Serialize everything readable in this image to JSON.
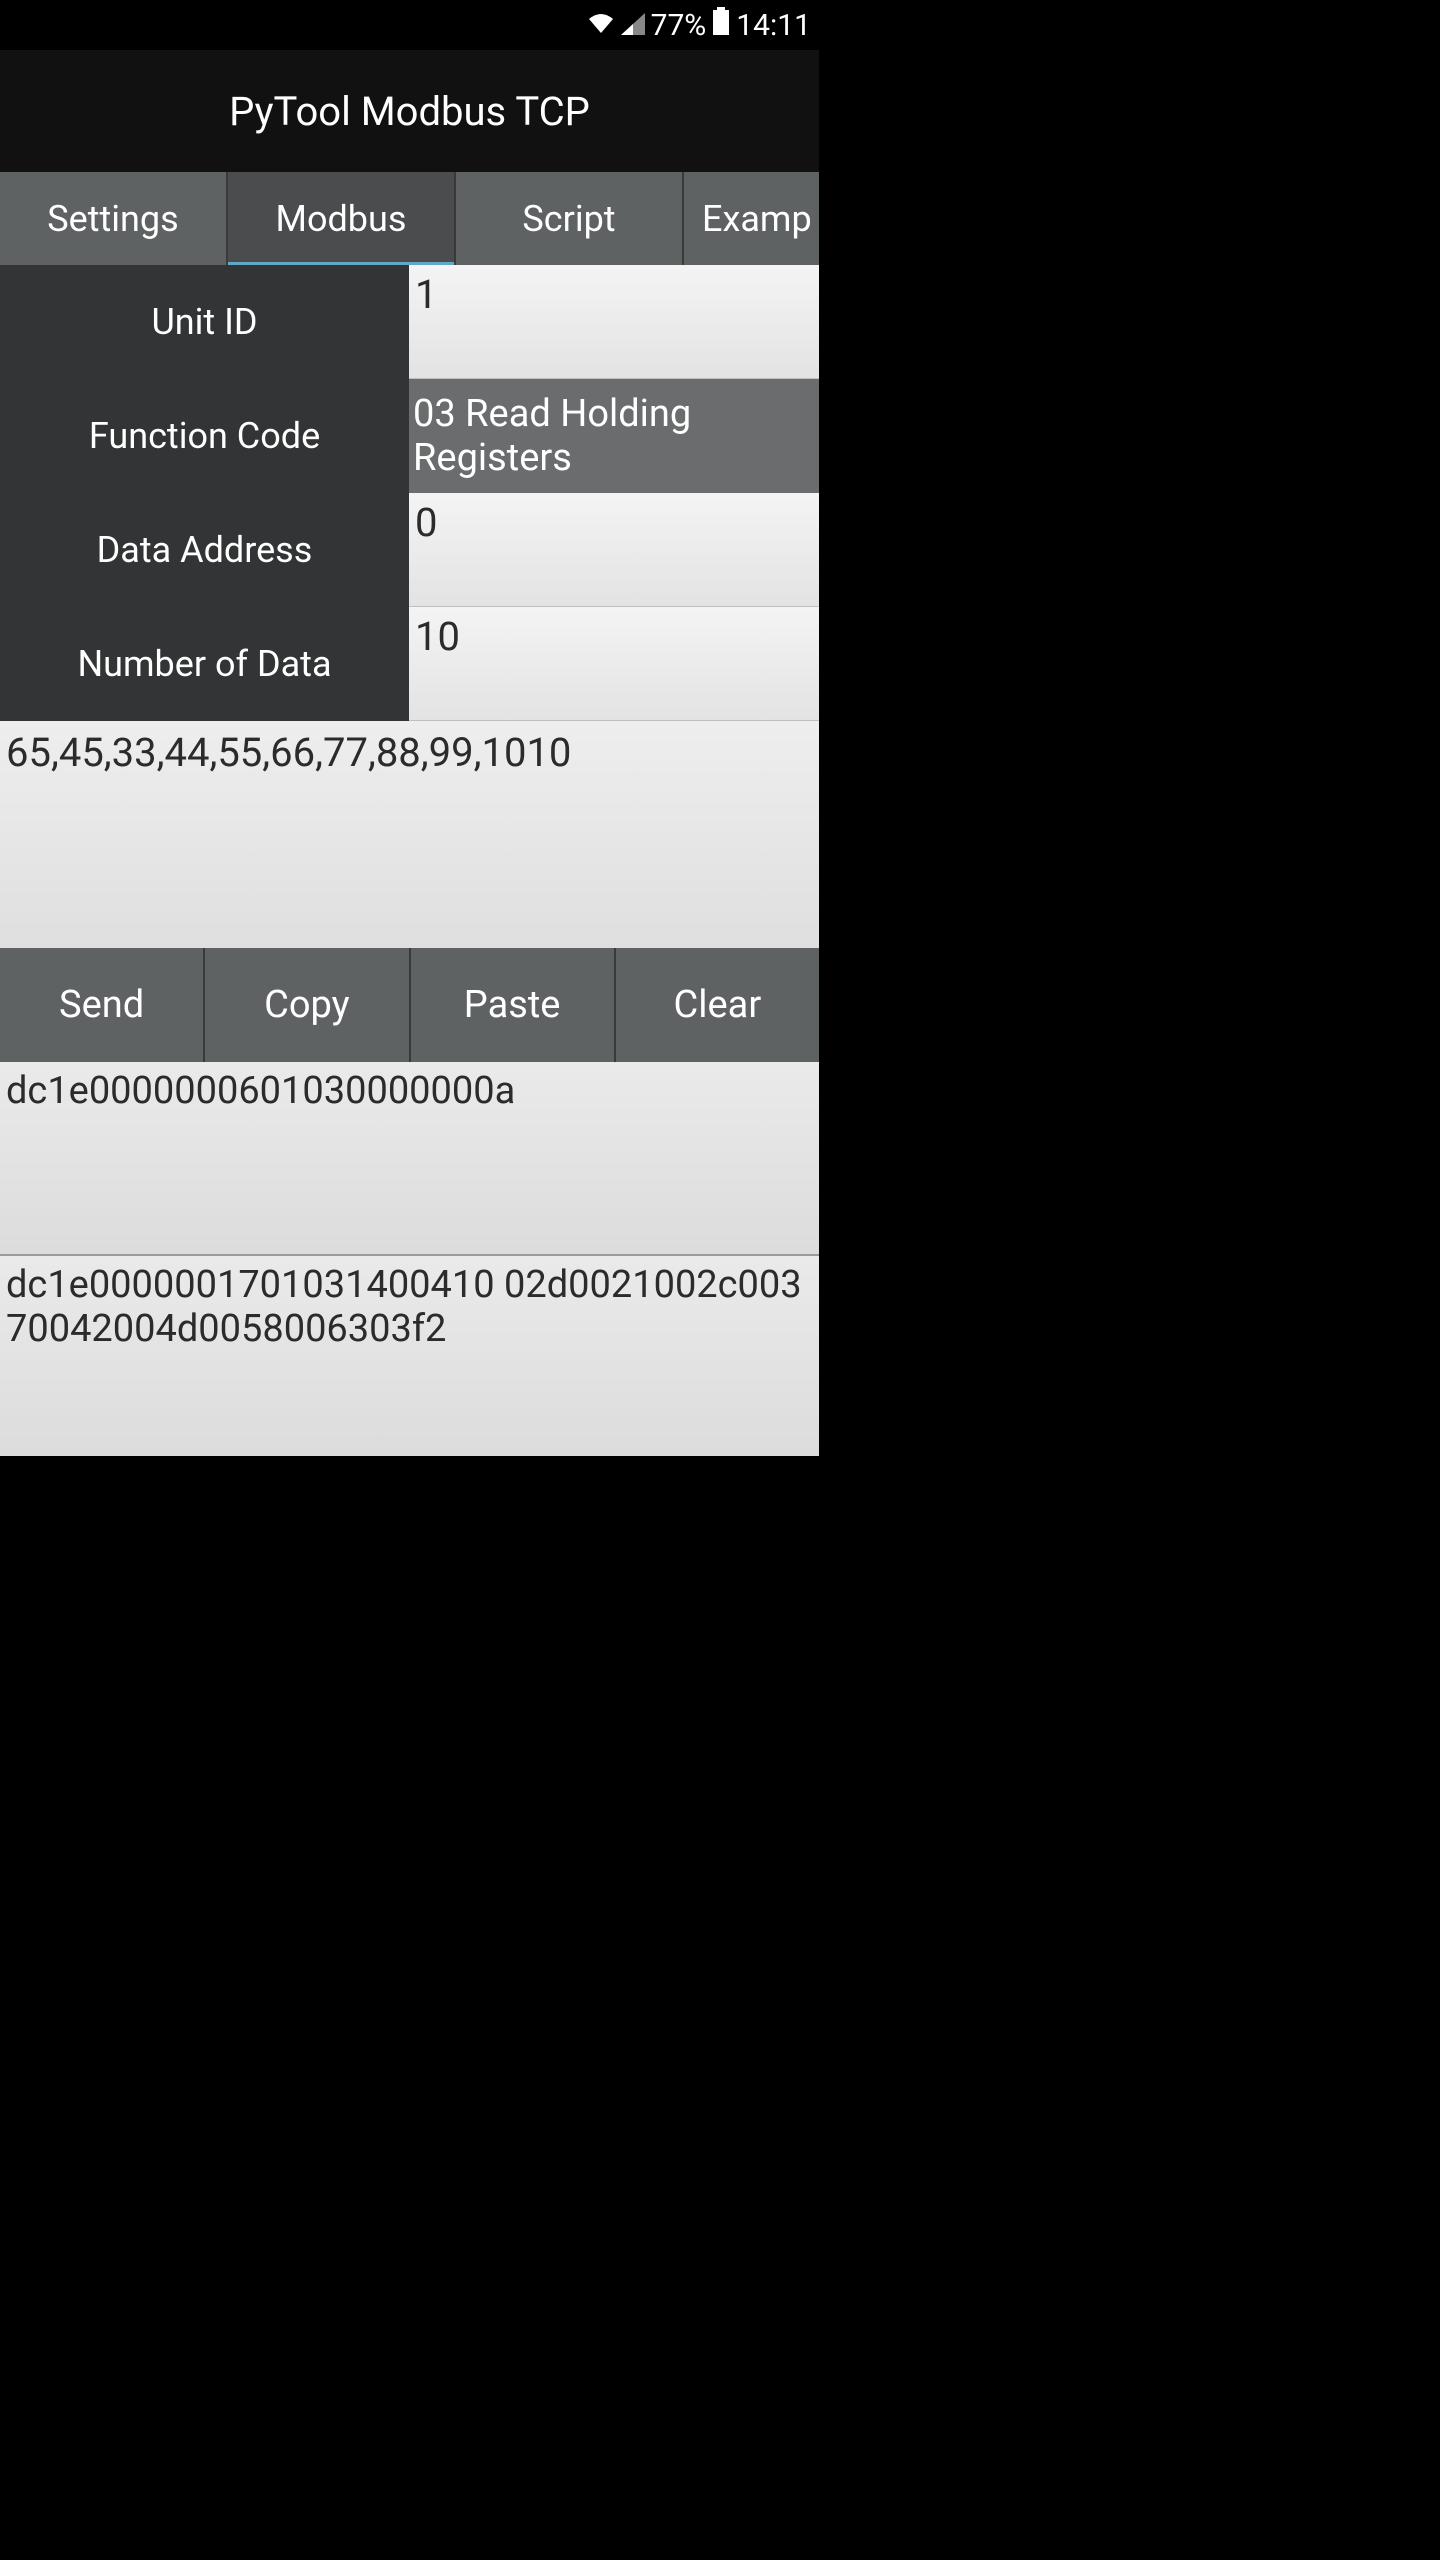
{
  "status_bar": {
    "battery_pct": "77%",
    "time": "14:11"
  },
  "app": {
    "title": "PyTool Modbus TCP"
  },
  "tabs": {
    "items": [
      {
        "label": "Settings",
        "active": false
      },
      {
        "label": "Modbus",
        "active": true
      },
      {
        "label": "Script",
        "active": false
      },
      {
        "label": "Examp",
        "active": false
      }
    ]
  },
  "form": {
    "unit_id": {
      "label": "Unit ID",
      "value": "1"
    },
    "function_code": {
      "label": "Function Code",
      "value": "03 Read Holding Registers"
    },
    "data_address": {
      "label": "Data Address",
      "value": "0"
    },
    "number_of_data": {
      "label": "Number of Data",
      "value": "10"
    }
  },
  "data_values": "65,45,33,44,55,66,77,88,99,1010",
  "actions": {
    "send": "Send",
    "copy": "Copy",
    "paste": "Paste",
    "clear": "Clear"
  },
  "request_hex": "dc1e0000000601030000000a",
  "response_hex": "dc1e0000001701031400410 02d0021002c00370042004d0058006303f2"
}
